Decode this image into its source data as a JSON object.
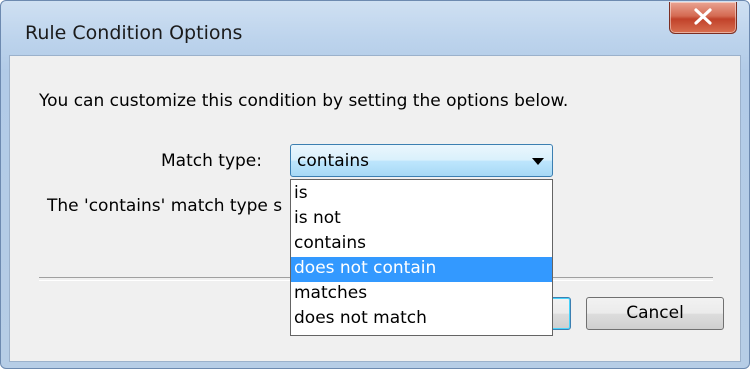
{
  "dialog": {
    "title": "Rule Condition Options",
    "close_label": "X",
    "description": "You can customize this condition by setting the options below.",
    "match_type_label": "Match type:",
    "selected_value": "contains",
    "info_text": "The 'contains' match type s",
    "options": [
      {
        "label": "is"
      },
      {
        "label": "is not"
      },
      {
        "label": "contains"
      },
      {
        "label": "does not contain",
        "highlighted": true
      },
      {
        "label": "matches"
      },
      {
        "label": "does not match"
      }
    ],
    "ok_label": "",
    "cancel_label": "Cancel"
  },
  "colors": {
    "highlight": "#3399ff",
    "close_button": "#c1422a",
    "title_bar": "#bcd3ec"
  },
  "icons": {
    "close": "close-icon",
    "dropdown": "chevron-down-icon"
  }
}
